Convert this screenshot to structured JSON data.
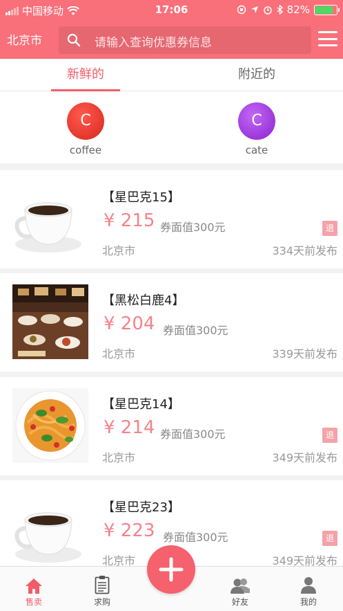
{
  "status_bar": {
    "carrier": "中国移动",
    "time": "17:06",
    "battery": "82%"
  },
  "header": {
    "city": "北京市",
    "search_placeholder": "请输入查询优惠券信息"
  },
  "tabs": [
    {
      "label": "新鲜的"
    },
    {
      "label": "附近的"
    }
  ],
  "categories": [
    {
      "letter": "C",
      "label": "coffee",
      "color": "#e83a3a"
    },
    {
      "letter": "C",
      "label": "cate",
      "color": "#a43ae0"
    }
  ],
  "coupons": [
    {
      "title": "【星巴克15】",
      "price": "¥ 215",
      "face_value": "券面值300元",
      "city": "北京市",
      "posted": "334天前发布",
      "refund": "退",
      "image": "coffee-cup"
    },
    {
      "title": "【黑松白鹿4】",
      "price": "¥ 204",
      "face_value": "券面值300元",
      "city": "北京市",
      "posted": "339天前发布",
      "refund": "",
      "image": "buffet"
    },
    {
      "title": "【星巴克14】",
      "price": "¥ 214",
      "face_value": "券面值300元",
      "city": "北京市",
      "posted": "349天前发布",
      "refund": "退",
      "image": "spaghetti"
    },
    {
      "title": "【星巴克23】",
      "price": "¥ 223",
      "face_value": "券面值300元",
      "city": "北京市",
      "posted": "349天前发布",
      "refund": "退",
      "image": "coffee-cup"
    }
  ],
  "bottom_nav": [
    {
      "label": "售卖",
      "icon": "home-icon",
      "active": true
    },
    {
      "label": "求购",
      "icon": "clipboard-icon",
      "active": false
    },
    {
      "label": "好友",
      "icon": "friends-icon",
      "active": false
    },
    {
      "label": "我的",
      "icon": "user-icon",
      "active": false
    }
  ],
  "colors": {
    "brand": "#f9707a",
    "accent": "#f25c68",
    "price": "#f6828a"
  }
}
